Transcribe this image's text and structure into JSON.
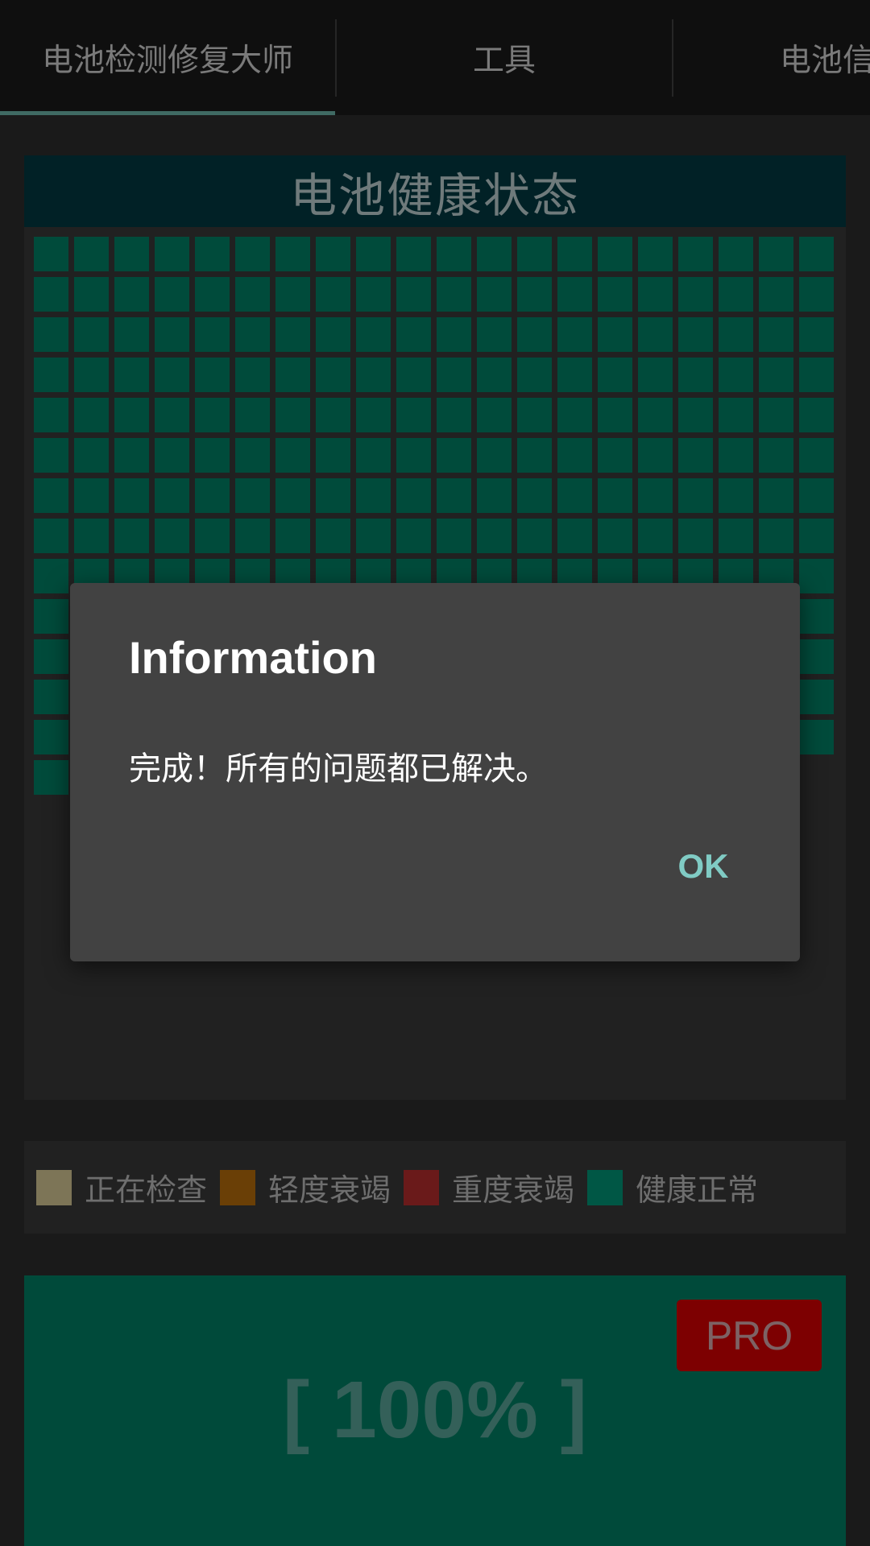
{
  "tabs": [
    {
      "label": "电池检测修复大师"
    },
    {
      "label": "工具"
    },
    {
      "label": "电池信"
    }
  ],
  "health_panel": {
    "title": "电池健康状态"
  },
  "legend": [
    {
      "label": "正在检查",
      "color": "#7d7557"
    },
    {
      "label": "轻度衰竭",
      "color": "#6a3f06"
    },
    {
      "label": "重度衰竭",
      "color": "#6a1a1a"
    },
    {
      "label": "健康正常",
      "color": "#005745"
    }
  ],
  "percent_panel": {
    "pro_label": "PRO",
    "percent": "[ 100% ]"
  },
  "dialog": {
    "title": "Information",
    "message": "完成！所有的问题都已解决。",
    "ok_label": "OK"
  },
  "colors": {
    "accent": "#80cbc4",
    "healthy_cell": "#004b3b",
    "panel_bg": "#212121",
    "pro_bg": "#7d0001"
  }
}
